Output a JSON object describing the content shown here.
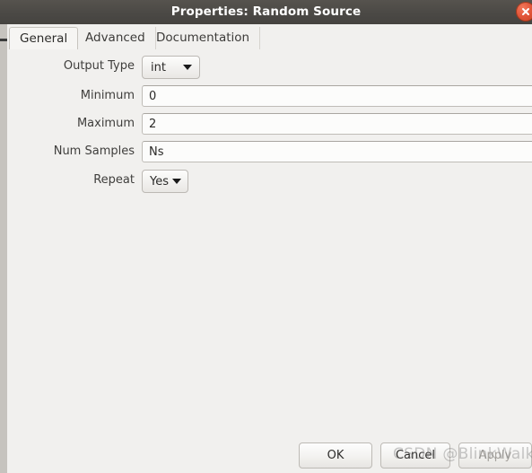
{
  "window": {
    "title": "Properties: Random Source",
    "close_icon": "close-icon",
    "titlebar_color": "#4b4945",
    "body_color": "#f1f0ee"
  },
  "tabs": [
    {
      "id": "general",
      "label": "General",
      "active": true
    },
    {
      "id": "advanced",
      "label": "Advanced",
      "active": false
    },
    {
      "id": "documentation",
      "label": "Documentation",
      "active": false
    }
  ],
  "form": {
    "rows": [
      {
        "label": "Output Type",
        "type": "combo",
        "value": "int",
        "placeholder": ""
      },
      {
        "label": "Minimum",
        "type": "text",
        "value": "0",
        "placeholder": ""
      },
      {
        "label": "Maximum",
        "type": "text",
        "value": "2",
        "placeholder": ""
      },
      {
        "label": "Num Samples",
        "type": "text",
        "value": "Ns",
        "placeholder": ""
      },
      {
        "label": "Repeat",
        "type": "combo",
        "value": "Yes",
        "placeholder": ""
      }
    ]
  },
  "buttons": {
    "ok": "OK",
    "cancel": "Cancel",
    "apply": "Apply",
    "apply_disabled": true
  },
  "watermark": {
    "text": "CSDN @BlinkWalk"
  }
}
